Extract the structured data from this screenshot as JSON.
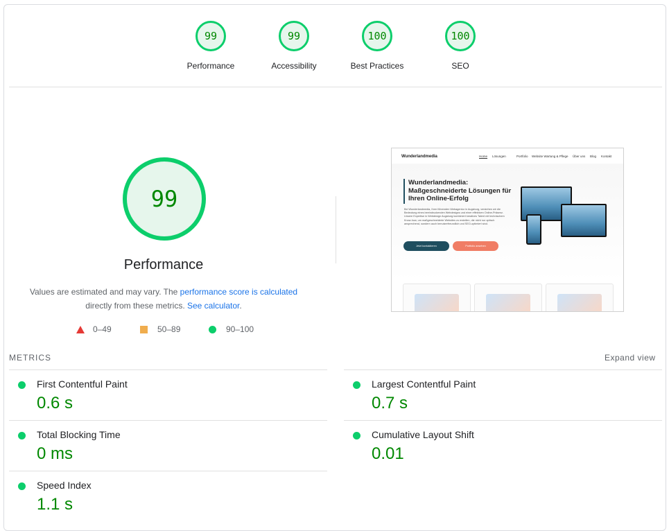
{
  "categories": [
    {
      "score": "99",
      "label": "Performance"
    },
    {
      "score": "99",
      "label": "Accessibility"
    },
    {
      "score": "100",
      "label": "Best Practices"
    },
    {
      "score": "100",
      "label": "SEO"
    }
  ],
  "main_gauge": {
    "score": "99",
    "title": "Performance"
  },
  "description": {
    "text1": "Values are estimated and may vary. The ",
    "link1": "performance score is calculated",
    "text2": "directly from these metrics. ",
    "link2": "See calculator",
    "text3": "."
  },
  "legend": {
    "fail": "0–49",
    "average": "50–89",
    "pass": "90–100"
  },
  "colors": {
    "pass": "#0cce6b",
    "pass_text": "#008800",
    "average": "#f0ad4e",
    "fail": "#e53935",
    "link": "#1a73e8"
  },
  "screenshot": {
    "brand": "Wunderlandmedia",
    "nav": [
      "Home",
      "Lösungen",
      "Portfolio",
      "Website Wartung & Pflege",
      "Über uns",
      "Blog",
      "Kontakt"
    ],
    "headline": "Wunderlandmedia: Maßgeschneiderte Lösungen für Ihren Online-Erfolg",
    "paragraph": "Bei Wunderlandmedia, Ihrer führenden Webagentur in Augsburg, verstehen wir die Bedeutung eines beeindruckenden Webdesigns und einer effektiven Online-Präsenz. Unsere Expertise in Webdesign Augsburg kombiniert kreatives Talent mit technischem Know-how, um maßgeschneiderte Websites zu erstellen, die nicht nur optisch ansprechend, sondern auch benutzerfreundlich und SEO-optimiert sind.",
    "cta_primary": "Jetzt kontaktieren",
    "cta_secondary": "Portfolio ansehen"
  },
  "metrics_section": {
    "title": "METRICS",
    "expand": "Expand view"
  },
  "metrics": [
    {
      "name": "First Contentful Paint",
      "value": "0.6 s"
    },
    {
      "name": "Largest Contentful Paint",
      "value": "0.7 s"
    },
    {
      "name": "Total Blocking Time",
      "value": "0 ms"
    },
    {
      "name": "Cumulative Layout Shift",
      "value": "0.01"
    },
    {
      "name": "Speed Index",
      "value": "1.1 s"
    }
  ]
}
